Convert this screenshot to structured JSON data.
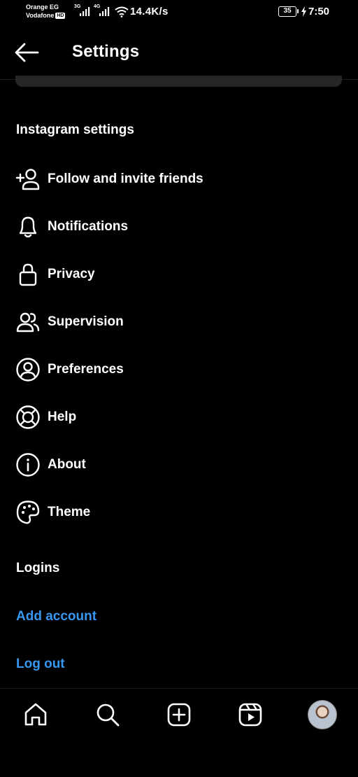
{
  "status_bar": {
    "carrier1": "Orange EG",
    "carrier2": "Vodafone",
    "volte": "VoLTE",
    "sim1_network": "3G",
    "sim2_network": "4G",
    "net_speed": "14.4K/s",
    "battery": "35",
    "time": "7:50"
  },
  "header": {
    "title": "Settings"
  },
  "sections": {
    "instagram_settings": "Instagram settings",
    "logins": "Logins"
  },
  "menu": [
    {
      "label": "Follow and invite friends",
      "icon": "add-person-icon"
    },
    {
      "label": "Notifications",
      "icon": "bell-icon"
    },
    {
      "label": "Privacy",
      "icon": "lock-icon"
    },
    {
      "label": "Supervision",
      "icon": "people-icon"
    },
    {
      "label": "Preferences",
      "icon": "user-circle-icon"
    },
    {
      "label": "Help",
      "icon": "lifebuoy-icon"
    },
    {
      "label": "About",
      "icon": "info-icon"
    },
    {
      "label": "Theme",
      "icon": "palette-icon"
    }
  ],
  "logins": {
    "add_account": "Add account",
    "log_out": "Log out"
  },
  "colors": {
    "background": "#000000",
    "text": "#ffffff",
    "link": "#3797f0"
  },
  "bottom_nav": [
    "home-icon",
    "search-icon",
    "create-icon",
    "reels-icon",
    "profile-avatar"
  ]
}
